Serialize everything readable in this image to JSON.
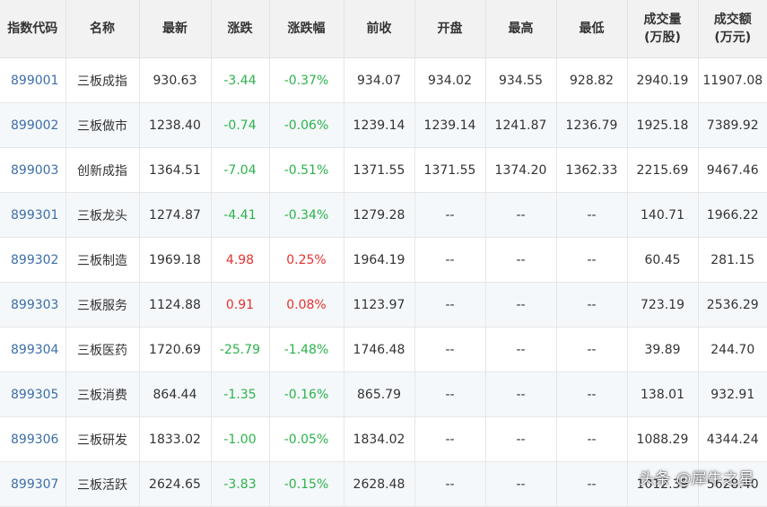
{
  "table": {
    "headers": [
      {
        "key": "code",
        "line1": "指数代码",
        "line2": ""
      },
      {
        "key": "name",
        "line1": "名称",
        "line2": ""
      },
      {
        "key": "latest",
        "line1": "最新",
        "line2": ""
      },
      {
        "key": "change",
        "line1": "涨跌",
        "line2": ""
      },
      {
        "key": "change_pct",
        "line1": "涨跌幅",
        "line2": ""
      },
      {
        "key": "prev_close",
        "line1": "前收",
        "line2": ""
      },
      {
        "key": "open",
        "line1": "开盘",
        "line2": ""
      },
      {
        "key": "high",
        "line1": "最高",
        "line2": ""
      },
      {
        "key": "low",
        "line1": "最低",
        "line2": ""
      },
      {
        "key": "volume",
        "line1": "成交量",
        "line2": "(万股)"
      },
      {
        "key": "amount",
        "line1": "成交额",
        "line2": "(万元)"
      }
    ],
    "rows": [
      {
        "code": "899001",
        "name": "三板成指",
        "latest": "930.63",
        "change": "-3.44",
        "change_pct": "-0.37%",
        "prev_close": "934.07",
        "open": "934.02",
        "high": "934.55",
        "low": "928.82",
        "volume": "2940.19",
        "amount": "11907.08",
        "direction": "down"
      },
      {
        "code": "899002",
        "name": "三板做市",
        "latest": "1238.40",
        "change": "-0.74",
        "change_pct": "-0.06%",
        "prev_close": "1239.14",
        "open": "1239.14",
        "high": "1241.87",
        "low": "1236.79",
        "volume": "1925.18",
        "amount": "7389.92",
        "direction": "down"
      },
      {
        "code": "899003",
        "name": "创新成指",
        "latest": "1364.51",
        "change": "-7.04",
        "change_pct": "-0.51%",
        "prev_close": "1371.55",
        "open": "1371.55",
        "high": "1374.20",
        "low": "1362.33",
        "volume": "2215.69",
        "amount": "9467.46",
        "direction": "down"
      },
      {
        "code": "899301",
        "name": "三板龙头",
        "latest": "1274.87",
        "change": "-4.41",
        "change_pct": "-0.34%",
        "prev_close": "1279.28",
        "open": "--",
        "high": "--",
        "low": "--",
        "volume": "140.71",
        "amount": "1966.22",
        "direction": "down"
      },
      {
        "code": "899302",
        "name": "三板制造",
        "latest": "1969.18",
        "change": "4.98",
        "change_pct": "0.25%",
        "prev_close": "1964.19",
        "open": "--",
        "high": "--",
        "low": "--",
        "volume": "60.45",
        "amount": "281.15",
        "direction": "up"
      },
      {
        "code": "899303",
        "name": "三板服务",
        "latest": "1124.88",
        "change": "0.91",
        "change_pct": "0.08%",
        "prev_close": "1123.97",
        "open": "--",
        "high": "--",
        "low": "--",
        "volume": "723.19",
        "amount": "2536.29",
        "direction": "up"
      },
      {
        "code": "899304",
        "name": "三板医药",
        "latest": "1720.69",
        "change": "-25.79",
        "change_pct": "-1.48%",
        "prev_close": "1746.48",
        "open": "--",
        "high": "--",
        "low": "--",
        "volume": "39.89",
        "amount": "244.70",
        "direction": "down"
      },
      {
        "code": "899305",
        "name": "三板消费",
        "latest": "864.44",
        "change": "-1.35",
        "change_pct": "-0.16%",
        "prev_close": "865.79",
        "open": "--",
        "high": "--",
        "low": "--",
        "volume": "138.01",
        "amount": "932.91",
        "direction": "down"
      },
      {
        "code": "899306",
        "name": "三板研发",
        "latest": "1833.02",
        "change": "-1.00",
        "change_pct": "-0.05%",
        "prev_close": "1834.02",
        "open": "--",
        "high": "--",
        "low": "--",
        "volume": "1088.29",
        "amount": "4344.24",
        "direction": "down"
      },
      {
        "code": "899307",
        "name": "三板活跃",
        "latest": "2624.65",
        "change": "-3.83",
        "change_pct": "-0.15%",
        "prev_close": "2628.48",
        "open": "--",
        "high": "--",
        "low": "--",
        "volume": "1012.39",
        "amount": "5628.40",
        "direction": "down"
      }
    ]
  },
  "watermark": "头条 @犀牛之星",
  "colors": {
    "header_bg": "#f2f2f2",
    "row_alt_bg": "#f5f8fb",
    "code_link": "#3d6ea8",
    "up": "#e5322d",
    "down": "#2bb34b"
  }
}
